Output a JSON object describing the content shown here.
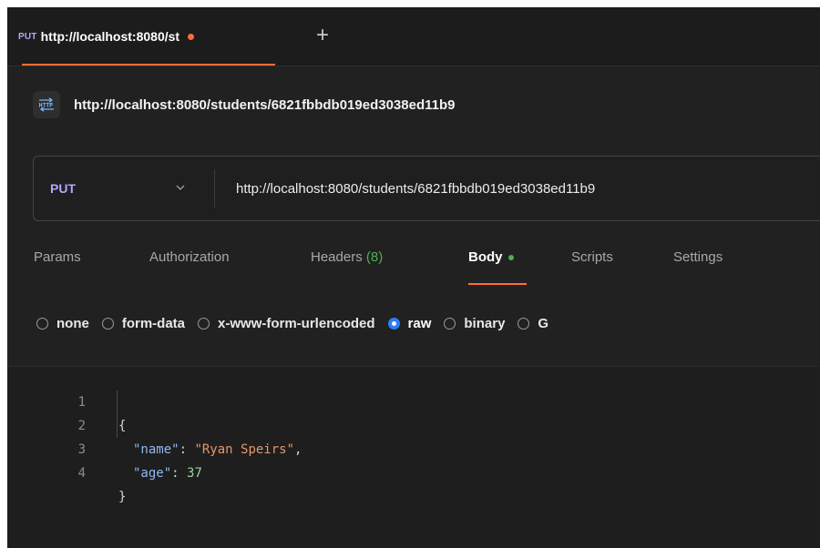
{
  "tab": {
    "method": "PUT",
    "title": "http://localhost:8080/st",
    "new_tab_label": "+"
  },
  "request": {
    "title": "http://localhost:8080/students/6821fbbdb019ed3038ed11b9",
    "method": "PUT",
    "url": "http://localhost:8080/students/6821fbbdb019ed3038ed11b9"
  },
  "request_tabs": [
    {
      "label": "Params"
    },
    {
      "label": "Authorization"
    },
    {
      "label": "Headers",
      "count": "(8)"
    },
    {
      "label": "Body"
    },
    {
      "label": "Scripts"
    },
    {
      "label": "Settings"
    }
  ],
  "body_types": [
    {
      "label": "none"
    },
    {
      "label": "form-data"
    },
    {
      "label": "x-www-form-urlencoded"
    },
    {
      "label": "raw",
      "selected": true
    },
    {
      "label": "binary"
    },
    {
      "label": "G"
    }
  ],
  "editor": {
    "line_numbers": [
      "1",
      "2",
      "3",
      "4"
    ],
    "line1": "{",
    "line2": {
      "key": "\"name\"",
      "colon": ": ",
      "value": "\"Ryan Speirs\"",
      "comma": ","
    },
    "line3": {
      "key": "\"age\"",
      "colon": ": ",
      "value": "37"
    },
    "line4": "}"
  },
  "colors": {
    "accent": "#ff6c37",
    "method": "#b3a6ff",
    "radio_selected": "#2f7cf6",
    "green": "#4caf50"
  }
}
